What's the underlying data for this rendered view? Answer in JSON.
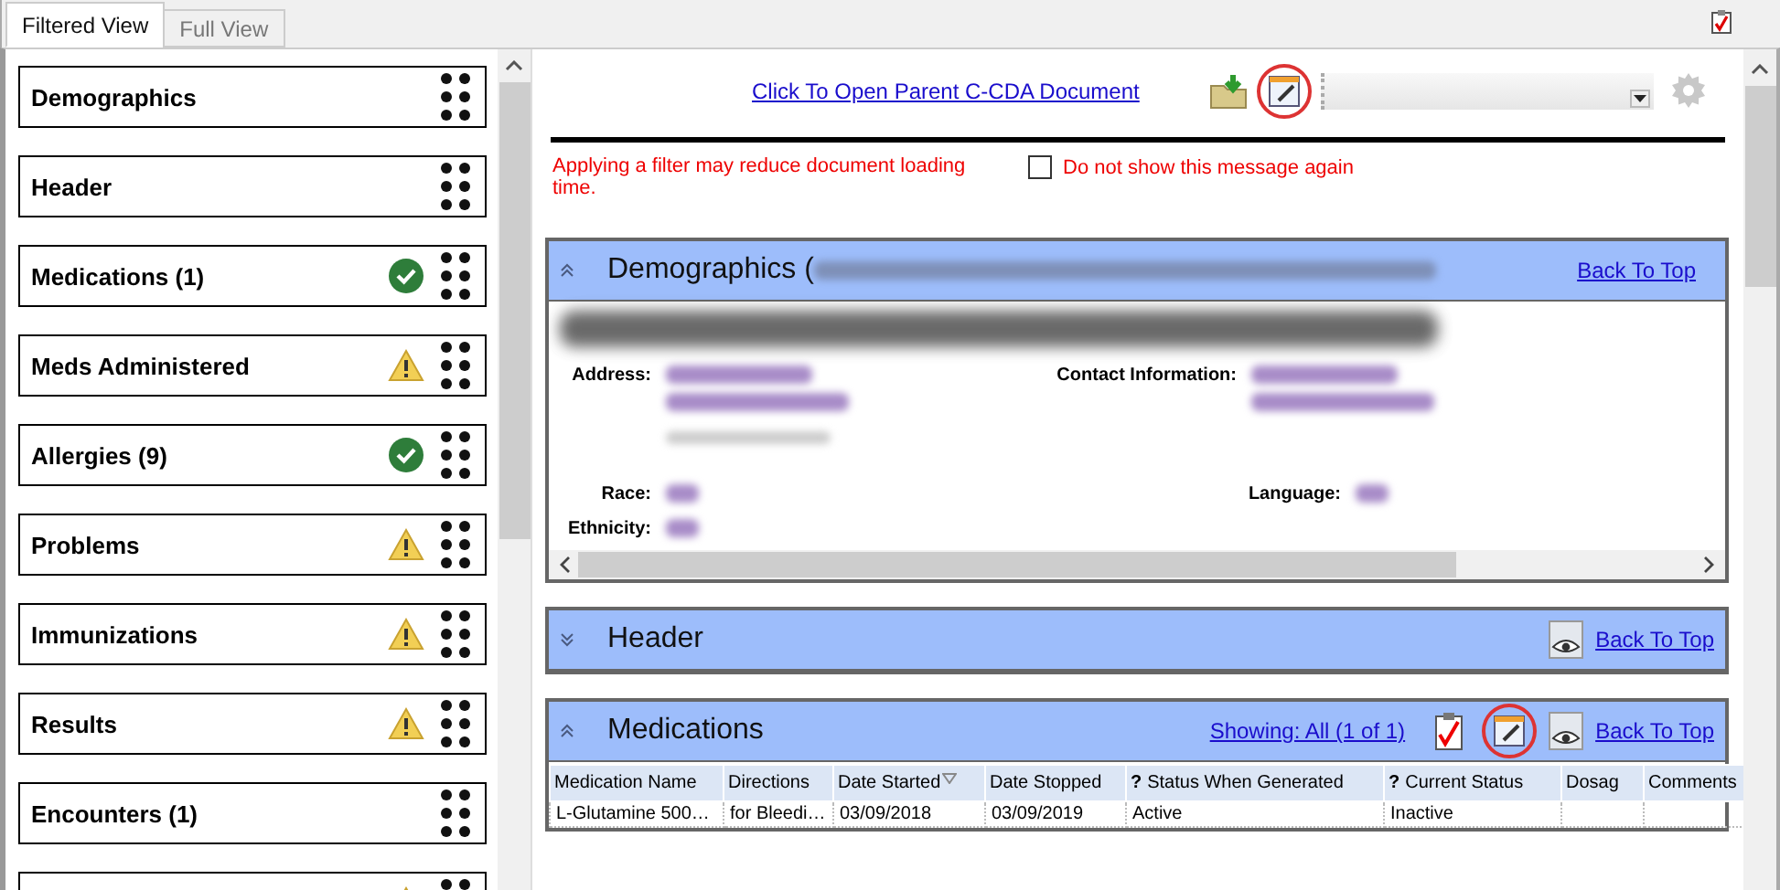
{
  "tabs": [
    {
      "label": "Filtered View",
      "selected": true
    },
    {
      "label": "Full View",
      "selected": false
    }
  ],
  "sidebar": {
    "items": [
      {
        "label": "Demographics",
        "kind": "plain"
      },
      {
        "label": "Header",
        "kind": "plain"
      },
      {
        "label": "Medications (1)",
        "kind": "ok"
      },
      {
        "label": "Meds Administered",
        "kind": "warning"
      },
      {
        "label": "Allergies (9)",
        "kind": "ok"
      },
      {
        "label": "Problems",
        "kind": "warning"
      },
      {
        "label": "Immunizations",
        "kind": "warning"
      },
      {
        "label": "Results",
        "kind": "warning"
      },
      {
        "label": "Encounters (1)",
        "kind": "plain"
      },
      {
        "kind": "warning"
      }
    ]
  },
  "toolbar": {
    "parent_link": "Click To Open Parent C-CDA Document"
  },
  "notice": {
    "message": "Applying a filter may reduce document loading time.",
    "checkbox_label": "Do not show this message again",
    "checked": false
  },
  "sections": [
    {
      "kind": "demographics",
      "title": "Demographics (",
      "expanded": true,
      "back_link": "Back To Top",
      "fields": [
        {
          "label": "Address:"
        },
        {
          "label": "Contact Information:"
        },
        {
          "label": "Race:"
        },
        {
          "label": "Language:"
        },
        {
          "label": "Ethnicity:"
        }
      ]
    },
    {
      "kind": "collapsed",
      "title": "Header",
      "expanded": false,
      "back_link": "Back To Top"
    },
    {
      "kind": "table",
      "title": "Medications",
      "expanded": true,
      "showing_link": "Showing: All (1 of 1)",
      "back_link": "Back To Top",
      "columns": [
        {
          "label": "Medication Name"
        },
        {
          "label": "Directions"
        },
        {
          "label": "Date Started",
          "sortable": true
        },
        {
          "label": "Date Stopped"
        },
        {
          "label": "Status When Generated",
          "help": "?"
        },
        {
          "label": "Current Status",
          "help": "?"
        },
        {
          "label": "Dosag"
        },
        {
          "label": "Comments"
        }
      ],
      "rows": [
        {
          "cells": [
            "L-Glutamine 500…",
            "for Bleedi…",
            "03/09/2018",
            "03/09/2019",
            "Active",
            "Inactive"
          ]
        }
      ]
    }
  ]
}
